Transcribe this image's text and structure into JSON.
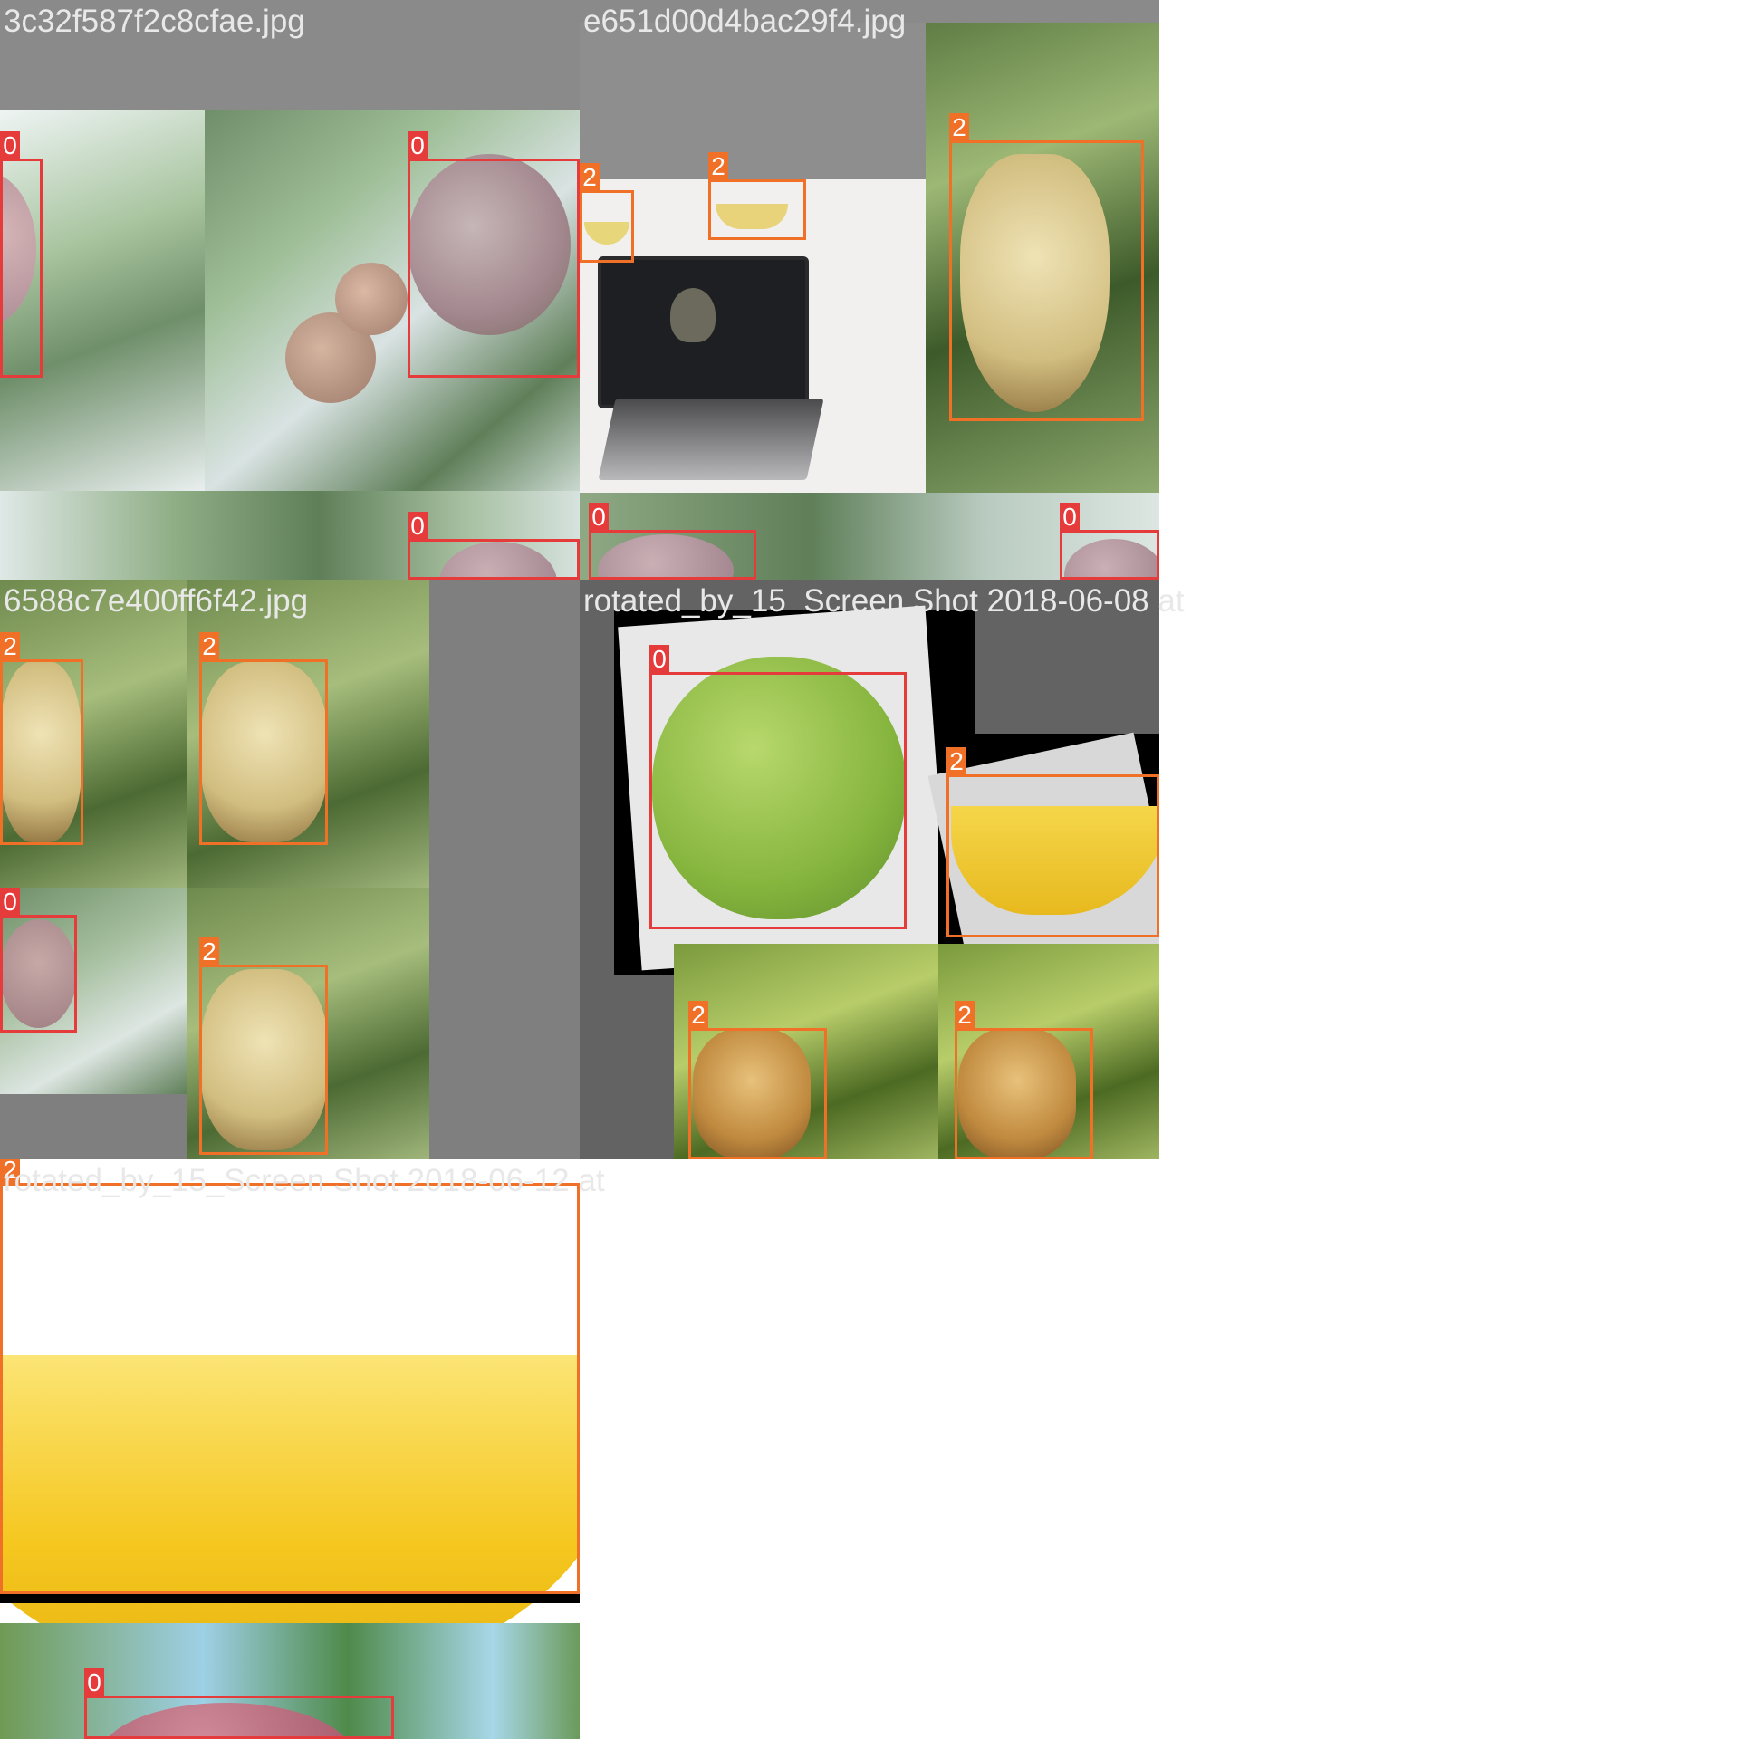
{
  "colors": {
    "class_0_box": "#e53b3b",
    "class_2_box": "#f07028",
    "title_text": "#e8e8e8",
    "padding_gray": "#7f7f7f"
  },
  "tiles": [
    {
      "title": "3c32f587f2c8cfae.jpg",
      "boxes": [
        {
          "label": "0",
          "class_name": "apple"
        },
        {
          "label": "0",
          "class_name": "apple"
        },
        {
          "label": "0",
          "class_name": "apple"
        },
        {
          "label": "0",
          "class_name": "apple"
        },
        {
          "label": "0",
          "class_name": "apple"
        }
      ]
    },
    {
      "title": "e651d00d4bac29f4.jpg",
      "boxes": [
        {
          "label": "2",
          "class_name": "banana"
        },
        {
          "label": "2",
          "class_name": "banana"
        },
        {
          "label": "2",
          "class_name": "banana"
        }
      ]
    },
    {
      "title": "6588c7e400ff6f42.jpg",
      "boxes": [
        {
          "label": "2",
          "class_name": "banana"
        },
        {
          "label": "2",
          "class_name": "banana"
        },
        {
          "label": "0",
          "class_name": "apple"
        },
        {
          "label": "2",
          "class_name": "banana"
        }
      ]
    },
    {
      "title": "rotated_by_15_Screen Shot 2018-06-08 at",
      "boxes": [
        {
          "label": "0",
          "class_name": "apple"
        },
        {
          "label": "2",
          "class_name": "banana"
        },
        {
          "label": "2",
          "class_name": "banana"
        },
        {
          "label": "2",
          "class_name": "banana"
        }
      ]
    },
    {
      "title": "rotated_by_15_Screen Shot 2018-06-12 at",
      "boxes": [
        {
          "label": "2",
          "class_name": "banana"
        },
        {
          "label": "0",
          "class_name": "apple"
        }
      ]
    }
  ]
}
